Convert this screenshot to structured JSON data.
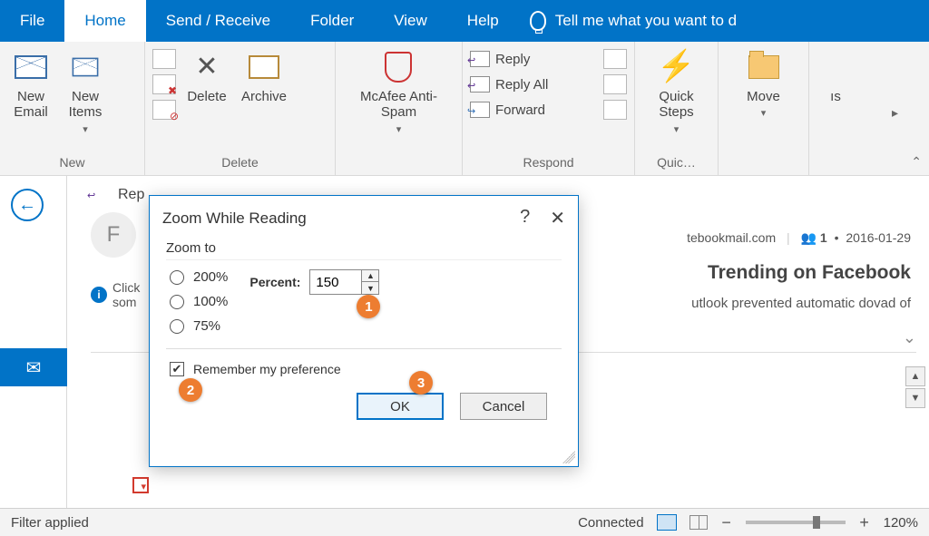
{
  "menu": {
    "file": "File",
    "home": "Home",
    "send_receive": "Send / Receive",
    "folder": "Folder",
    "view": "View",
    "help": "Help",
    "tell_me": "Tell me what you want to d"
  },
  "ribbon": {
    "new_group": "New",
    "new_email": "New\nEmail",
    "new_items": "New\nItems",
    "delete_group": "Delete",
    "delete_btn": "Delete",
    "archive_btn": "Archive",
    "antispam_group": "",
    "antispam_btn": "McAfee Anti-\nSpam",
    "respond_group": "Respond",
    "reply": "Reply",
    "reply_all": "Reply All",
    "forward": "Forward",
    "quick_group": "Quic…",
    "quick_steps": "Quick\nSteps",
    "move_btn": "Move",
    "more_btn": "ıs"
  },
  "message": {
    "reply_label": "Rep",
    "avatar_initial": "F",
    "info_prefix": "Click",
    "info_next": "som",
    "from_domain": "tebookmail.com",
    "people_count": "1",
    "date": "2016-01-29",
    "subject_tail": "Trending on Facebook",
    "prevented": "utlook prevented automatic dovad of"
  },
  "dialog": {
    "title": "Zoom While Reading",
    "zoom_to": "Zoom to",
    "opt_200": "200%",
    "opt_100": "100%",
    "opt_75": "75%",
    "percent_label": "Percent:",
    "percent_value": "150",
    "remember": "Remember my preference",
    "ok": "OK",
    "cancel": "Cancel",
    "callout1": "1",
    "callout2": "2",
    "callout3": "3"
  },
  "status": {
    "filter": "Filter applied",
    "connected": "Connected",
    "zoom": "120%"
  }
}
